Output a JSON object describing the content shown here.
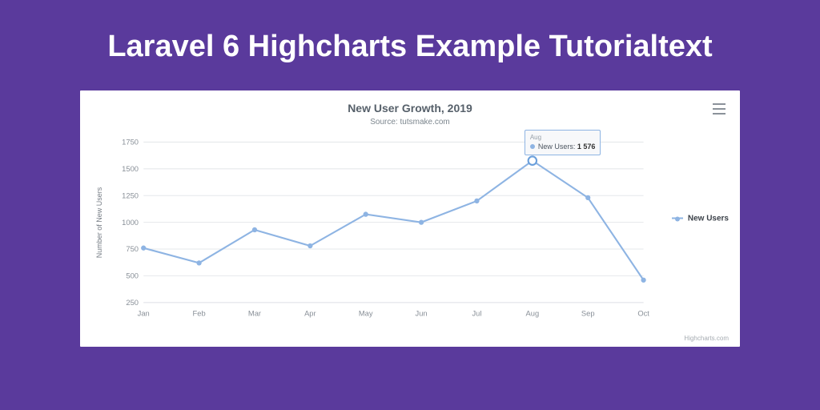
{
  "page": {
    "title": "Laravel 6 Highcharts Example Tutorialtext"
  },
  "chart_data": {
    "type": "line",
    "title": "New User Growth, 2019",
    "subtitle": "Source: tutsmake.com",
    "xlabel": "",
    "ylabel": "Number of New Users",
    "categories": [
      "Jan",
      "Feb",
      "Mar",
      "Apr",
      "May",
      "Jun",
      "Jul",
      "Aug",
      "Sep",
      "Oct"
    ],
    "y_ticks": [
      250,
      500,
      750,
      1000,
      1250,
      1500,
      1750
    ],
    "ylim": [
      250,
      1750
    ],
    "series": [
      {
        "name": "New Users",
        "values": [
          760,
          620,
          930,
          780,
          1075,
          1000,
          1200,
          1576,
          1230,
          460
        ]
      }
    ],
    "legend_position": "right",
    "highlight": {
      "month": "Aug",
      "series": "New Users",
      "value_text": "1 576"
    },
    "credit": "Highcharts.com"
  }
}
